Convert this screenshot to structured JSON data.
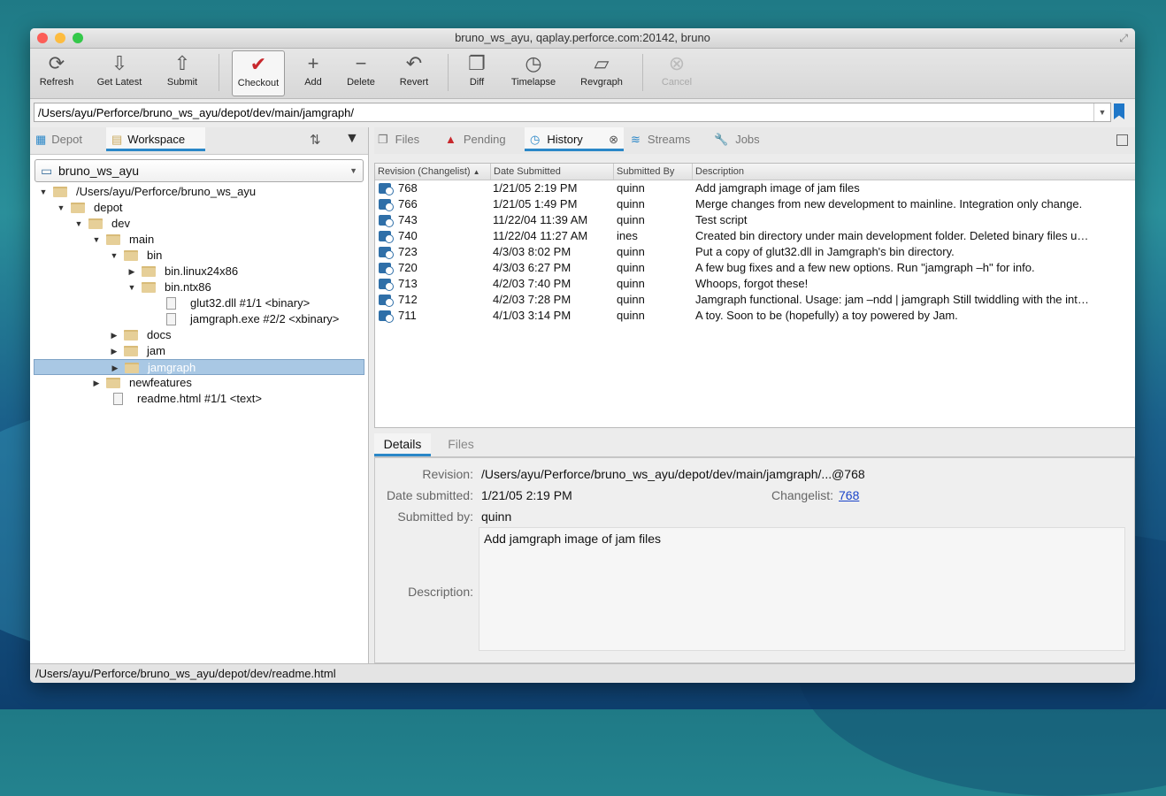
{
  "window": {
    "title": "bruno_ws_ayu,  qaplay.perforce.com:20142,  bruno"
  },
  "toolbar": {
    "buttons": [
      {
        "label": "Refresh",
        "icon": "refresh-icon",
        "glyph": "⟳"
      },
      {
        "label": "Get Latest",
        "icon": "get-latest-icon",
        "glyph": "⇩"
      },
      {
        "label": "Submit",
        "icon": "submit-icon",
        "glyph": "⇧"
      },
      {
        "label": "Checkout",
        "icon": "checkmark-icon",
        "glyph": "✔"
      },
      {
        "label": "Add",
        "icon": "plus-icon",
        "glyph": "+"
      },
      {
        "label": "Delete",
        "icon": "minus-icon",
        "glyph": "−"
      },
      {
        "label": "Revert",
        "icon": "revert-icon",
        "glyph": "↶"
      },
      {
        "label": "Diff",
        "icon": "diff-icon",
        "glyph": "❐"
      },
      {
        "label": "Timelapse",
        "icon": "clock-icon",
        "glyph": "◷"
      },
      {
        "label": "Revgraph",
        "icon": "revgraph-icon",
        "glyph": "▱"
      },
      {
        "label": "Cancel",
        "icon": "cancel-icon",
        "glyph": "⊗"
      }
    ]
  },
  "path": {
    "value": "/Users/ayu/Perforce/bruno_ws_ayu/depot/dev/main/jamgraph/"
  },
  "left_tabs": {
    "depot": "Depot",
    "workspace": "Workspace"
  },
  "workspace_select": {
    "value": "bruno_ws_ayu"
  },
  "tree": [
    {
      "label": "/Users/ayu/Perforce/bruno_ws_ayu",
      "type": "folder",
      "arrow": "▼"
    },
    {
      "label": "depot",
      "type": "folder",
      "arrow": "▼"
    },
    {
      "label": "dev",
      "type": "folder",
      "arrow": "▼"
    },
    {
      "label": "main",
      "type": "folder",
      "arrow": "▼"
    },
    {
      "label": "bin",
      "type": "folder",
      "arrow": "▼"
    },
    {
      "label": "bin.linux24x86",
      "type": "folder",
      "arrow": "▶"
    },
    {
      "label": "bin.ntx86",
      "type": "folder",
      "arrow": "▼"
    },
    {
      "label": "glut32.dll #1/1 <binary>",
      "type": "file",
      "arrow": ""
    },
    {
      "label": "jamgraph.exe #2/2 <xbinary>",
      "type": "file",
      "arrow": ""
    },
    {
      "label": "docs",
      "type": "folder",
      "arrow": "▶"
    },
    {
      "label": "jam",
      "type": "folder",
      "arrow": "▶"
    },
    {
      "label": "jamgraph",
      "type": "folder",
      "arrow": "▶",
      "selected": true
    },
    {
      "label": "newfeatures",
      "type": "folder",
      "arrow": "▶"
    },
    {
      "label": "readme.html #1/1 <text>",
      "type": "file",
      "arrow": ""
    }
  ],
  "right_tabs": {
    "files": "Files",
    "pending": "Pending",
    "history": "History",
    "streams": "Streams",
    "jobs": "Jobs"
  },
  "history": {
    "columns": [
      "Revision (Changelist)",
      "Date Submitted",
      "Submitted By",
      "Description"
    ],
    "rows": [
      [
        "768",
        "1/21/05 2:19 PM",
        "quinn",
        "Add jamgraph image of jam files"
      ],
      [
        "766",
        "1/21/05 1:49 PM",
        "quinn",
        "Merge changes from new development to mainline. Integration only change."
      ],
      [
        "743",
        "11/22/04 11:39 AM",
        "quinn",
        "Test script"
      ],
      [
        "740",
        "11/22/04 11:27 AM",
        "ines",
        "Created bin directory under main development folder. Deleted binary files u…"
      ],
      [
        "723",
        "4/3/03 8:02 PM",
        "quinn",
        "Put a copy of glut32.dll in Jamgraph's bin directory."
      ],
      [
        "720",
        "4/3/03 6:27 PM",
        "quinn",
        "A few bug fixes and a few new options. Run \"jamgraph –h\" for info."
      ],
      [
        "713",
        "4/2/03 7:40 PM",
        "quinn",
        "Whoops, forgot these!"
      ],
      [
        "712",
        "4/2/03 7:28 PM",
        "quinn",
        "Jamgraph functional. Usage: jam –ndd | jamgraph Still twiddling with the int…"
      ],
      [
        "711",
        "4/1/03 3:14 PM",
        "quinn",
        "A toy. Soon to be (hopefully) a toy powered by Jam."
      ]
    ]
  },
  "detail_tabs": {
    "details": "Details",
    "files": "Files"
  },
  "details": {
    "revision_label": "Revision:",
    "revision": "/Users/ayu/Perforce/bruno_ws_ayu/depot/dev/main/jamgraph/...@768",
    "date_label": "Date submitted:",
    "date": "1/21/05 2:19 PM",
    "changelist_label": "Changelist:",
    "changelist": "768",
    "by_label": "Submitted by:",
    "by": "quinn",
    "desc_label": "Description:",
    "desc": "Add jamgraph image of jam files"
  },
  "status": {
    "text": "/Users/ayu/Perforce/bruno_ws_ayu/depot/dev/readme.html"
  }
}
